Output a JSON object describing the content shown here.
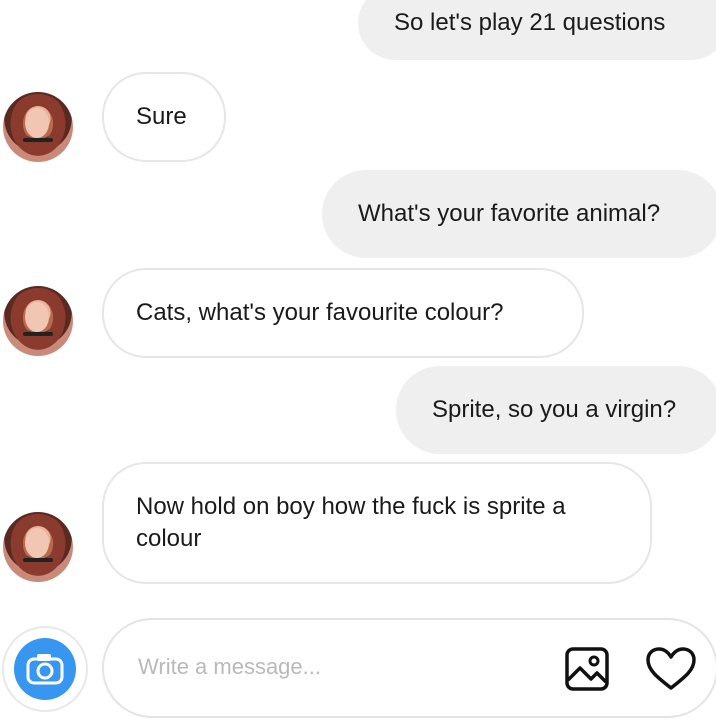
{
  "messages": [
    {
      "direction": "sent",
      "text": "So let's play 21 questions"
    },
    {
      "direction": "received",
      "text": "Sure"
    },
    {
      "direction": "sent",
      "text": "What's your favorite animal?"
    },
    {
      "direction": "received",
      "text": "Cats, what's your favourite colour?"
    },
    {
      "direction": "sent",
      "text": "Sprite, so you a virgin?"
    },
    {
      "direction": "received",
      "text": "Now hold on boy how the fuck is sprite a colour"
    }
  ],
  "composer": {
    "placeholder": "Write a message...",
    "camera_icon": "camera-icon",
    "gallery_icon": "image-icon",
    "like_icon": "heart-icon"
  },
  "colors": {
    "accent": "#3797f0",
    "sent_bubble": "#efefef",
    "received_border": "#e6e6e6"
  }
}
